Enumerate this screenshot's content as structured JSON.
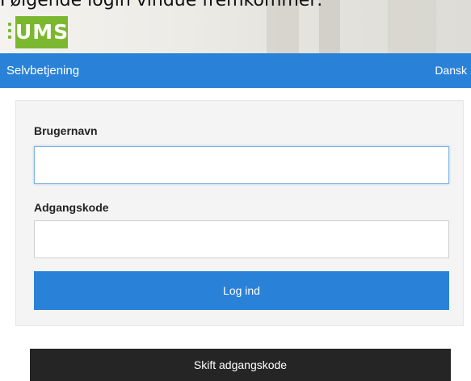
{
  "caption": "Følgende login vindue fremkommer:",
  "logo": {
    "text": "UMS"
  },
  "navbar": {
    "title": "Selvbetjening",
    "language": "Dansk"
  },
  "form": {
    "username_label": "Brugernavn",
    "username_value": "",
    "password_label": "Adgangskode",
    "password_value": "",
    "login_label": "Log ind"
  },
  "change_password_label": "Skift adgangskode",
  "colors": {
    "accent": "#2a82d8",
    "logo": "#7cb82f",
    "dark_button": "#252525"
  }
}
